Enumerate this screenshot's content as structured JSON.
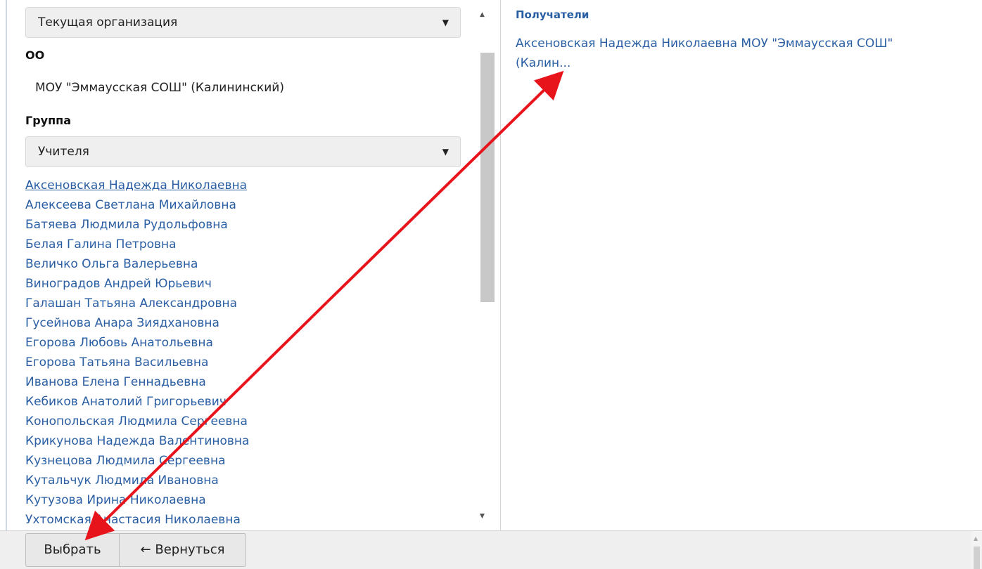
{
  "scope_select": {
    "value": "Текущая организация"
  },
  "org": {
    "label": "ОО",
    "value": "МОУ \"Эммаусская СОШ\" (Калининский)"
  },
  "group": {
    "label": "Группа",
    "value": "Учителя"
  },
  "people": [
    "Аксеновская Надежда Николаевна",
    "Алексеева Светлана Михайловна",
    "Батяева Людмила Рудольфовна",
    "Белая Галина Петровна",
    "Величко Ольга Валерьевна",
    "Виноградов Андрей Юрьевич",
    "Галашан Татьяна Александровна",
    "Гусейнова Анара Зиядхановна",
    "Егорова Любовь Анатольевна",
    "Егорова Татьяна Васильевна",
    "Иванова Елена Геннадьевна",
    "Кебиков Анатолий Григорьевич",
    "Конопольская Людмила Сергеевна",
    "Крикунова Надежда Валентиновна",
    "Кузнецова Людмила Сергеевна",
    "Кутальчук Людмила Ивановна",
    "Кутузова Ирина Николаевна",
    "Ухтомская Анастасия Николаевна"
  ],
  "recipients": {
    "title": "Получатели",
    "items": [
      "Аксеновская Надежда Николаевна МОУ \"Эммаусская СОШ\" (Калин..."
    ]
  },
  "footer": {
    "select_button": "Выбрать",
    "back_button": "← Вернуться"
  },
  "colors": {
    "link": "#2a5ea3",
    "annotation_arrow": "#e8141b"
  }
}
